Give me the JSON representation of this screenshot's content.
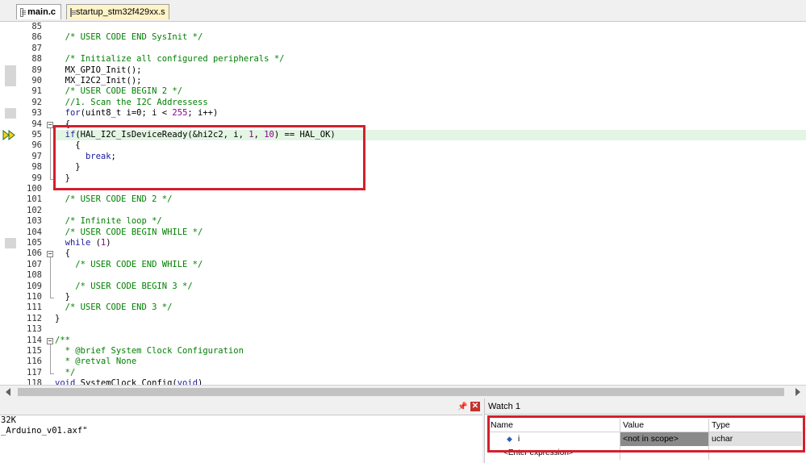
{
  "tabs": [
    {
      "label": "main.c",
      "active": true
    },
    {
      "label": "startup_stm32f429xx.s",
      "active": false
    }
  ],
  "editor": {
    "current_line": 95,
    "lines": [
      {
        "num": "85",
        "text": ""
      },
      {
        "num": "86",
        "text": "  /* USER CODE END SysInit */"
      },
      {
        "num": "87",
        "text": ""
      },
      {
        "num": "88",
        "text": "  /* Initialize all configured peripherals */"
      },
      {
        "num": "89",
        "text": "  MX_GPIO_Init();"
      },
      {
        "num": "90",
        "text": "  MX_I2C2_Init();"
      },
      {
        "num": "91",
        "text": "  /* USER CODE BEGIN 2 */"
      },
      {
        "num": "92",
        "text": "  //1. Scan the I2C Addressess"
      },
      {
        "num": "93",
        "text": "  for(uint8_t i=0; i < 255; i++)"
      },
      {
        "num": "94",
        "text": "  {"
      },
      {
        "num": "95",
        "text": "  if(HAL_I2C_IsDeviceReady(&hi2c2, i, 1, 10) == HAL_OK)"
      },
      {
        "num": "96",
        "text": "    {"
      },
      {
        "num": "97",
        "text": "      break;"
      },
      {
        "num": "98",
        "text": "    }"
      },
      {
        "num": "99",
        "text": "  }"
      },
      {
        "num": "100",
        "text": ""
      },
      {
        "num": "101",
        "text": "  /* USER CODE END 2 */"
      },
      {
        "num": "102",
        "text": ""
      },
      {
        "num": "103",
        "text": "  /* Infinite loop */"
      },
      {
        "num": "104",
        "text": "  /* USER CODE BEGIN WHILE */"
      },
      {
        "num": "105",
        "text": "  while (1)"
      },
      {
        "num": "106",
        "text": "  {"
      },
      {
        "num": "107",
        "text": "    /* USER CODE END WHILE */"
      },
      {
        "num": "108",
        "text": ""
      },
      {
        "num": "109",
        "text": "    /* USER CODE BEGIN 3 */"
      },
      {
        "num": "110",
        "text": "  }"
      },
      {
        "num": "111",
        "text": "  /* USER CODE END 3 */"
      },
      {
        "num": "112",
        "text": "}"
      },
      {
        "num": "113",
        "text": ""
      },
      {
        "num": "114",
        "text": "/**"
      },
      {
        "num": "115",
        "text": "  * @brief System Clock Configuration"
      },
      {
        "num": "116",
        "text": "  * @retval None"
      },
      {
        "num": "117",
        "text": "  */"
      },
      {
        "num": "118",
        "text": "void SystemClock_Config(void)"
      }
    ]
  },
  "build_output": {
    "lines": [
      "32K",
      "_Arduino_v01.axf\""
    ]
  },
  "watch": {
    "title": "Watch 1",
    "columns": [
      "Name",
      "Value",
      "Type"
    ],
    "rows": [
      {
        "name": "i",
        "value": "<not in scope>",
        "type": "uchar"
      }
    ],
    "enter_expression": "<Enter expression>"
  },
  "colors": {
    "comment": "#008000",
    "keyword": "#1a1a9e",
    "number": "#8b008b",
    "highlight_box": "#d3202e",
    "current_line_bg": "#e3f5e3",
    "startup_tab_bg": "#fff3c8"
  },
  "icons": [
    "file-icon",
    "execution-arrow-icon",
    "pin-icon",
    "close-icon",
    "fold-toggle-icon"
  ]
}
